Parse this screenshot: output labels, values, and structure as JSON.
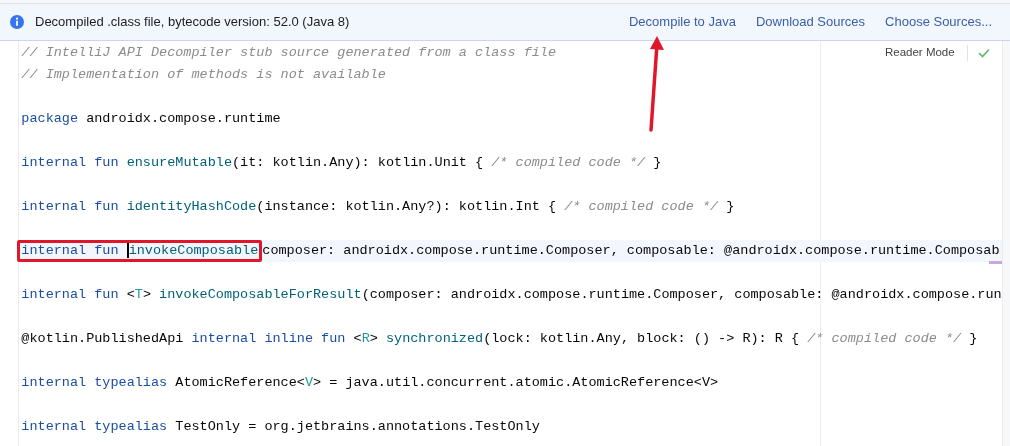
{
  "banner": {
    "message": "Decompiled .class file, bytecode version: 52.0 (Java 8)",
    "actions": [
      "Decompile to Java",
      "Download Sources",
      "Choose Sources..."
    ]
  },
  "editor": {
    "reader_mode": "Reader Mode",
    "lines": [
      {
        "kind": "code",
        "current": false,
        "tokens": [
          {
            "kind": "comment",
            "text": "// IntelliJ API Decompiler stub source generated from a class file"
          }
        ]
      },
      {
        "kind": "code",
        "current": false,
        "tokens": [
          {
            "kind": "comment",
            "text": "// Implementation of methods is not available"
          }
        ]
      },
      {
        "kind": "blank"
      },
      {
        "kind": "code",
        "current": false,
        "tokens": [
          {
            "kind": "keyword",
            "text": "package "
          },
          {
            "kind": "plain",
            "text": "androidx.compose.runtime"
          }
        ]
      },
      {
        "kind": "blank"
      },
      {
        "kind": "code",
        "current": false,
        "tokens": [
          {
            "kind": "keyword",
            "text": "internal fun "
          },
          {
            "kind": "function",
            "text": "ensureMutable"
          },
          {
            "kind": "plain",
            "text": "(it: kotlin.Any): kotlin.Unit { "
          },
          {
            "kind": "comment",
            "text": "/* compiled code */"
          },
          {
            "kind": "plain",
            "text": " }"
          }
        ]
      },
      {
        "kind": "blank"
      },
      {
        "kind": "code",
        "current": false,
        "tokens": [
          {
            "kind": "keyword",
            "text": "internal fun "
          },
          {
            "kind": "function",
            "text": "identityHashCode"
          },
          {
            "kind": "plain",
            "text": "(instance: kotlin.Any?): kotlin.Int { "
          },
          {
            "kind": "comment",
            "text": "/* compiled code */"
          },
          {
            "kind": "plain",
            "text": " }"
          }
        ]
      },
      {
        "kind": "blank"
      },
      {
        "kind": "code",
        "current": true,
        "tokens": [
          {
            "kind": "keyword",
            "text": "internal fun ",
            "boxed": true,
            "caret": false
          },
          {
            "kind": "function",
            "text": "invokeComposable",
            "boxed": true,
            "caret": true
          },
          {
            "kind": "plain",
            "text": "composer: androidx.compose.runtime.Composer, composable: @androidx.compose.runtime.Composab",
            "boxed": false,
            "caret": false
          }
        ]
      },
      {
        "kind": "blank"
      },
      {
        "kind": "code",
        "current": false,
        "tokens": [
          {
            "kind": "keyword",
            "text": "internal fun "
          },
          {
            "kind": "plain",
            "text": "<"
          },
          {
            "kind": "type_param",
            "text": "T"
          },
          {
            "kind": "plain",
            "text": "> "
          },
          {
            "kind": "function",
            "text": "invokeComposableForResult"
          },
          {
            "kind": "plain",
            "text": "(composer: androidx.compose.runtime.Composer, composable: @androidx.compose.run"
          }
        ]
      },
      {
        "kind": "blank"
      },
      {
        "kind": "code",
        "current": false,
        "tokens": [
          {
            "kind": "plain",
            "text": "@kotlin.PublishedApi "
          },
          {
            "kind": "keyword",
            "text": "internal inline fun "
          },
          {
            "kind": "plain",
            "text": "<"
          },
          {
            "kind": "type_param",
            "text": "R"
          },
          {
            "kind": "plain",
            "text": "> "
          },
          {
            "kind": "function",
            "text": "synchronized"
          },
          {
            "kind": "plain",
            "text": "(lock: kotlin.Any, block: () -> R): R { "
          },
          {
            "kind": "comment",
            "text": "/* compiled code */"
          },
          {
            "kind": "plain",
            "text": " }"
          }
        ]
      },
      {
        "kind": "blank"
      },
      {
        "kind": "code",
        "current": false,
        "tokens": [
          {
            "kind": "keyword",
            "text": "internal typealias "
          },
          {
            "kind": "plain",
            "text": "AtomicReference<"
          },
          {
            "kind": "type_param",
            "text": "V"
          },
          {
            "kind": "plain",
            "text": "> = java.util.concurrent.atomic.AtomicReference<V>"
          }
        ]
      },
      {
        "kind": "blank"
      },
      {
        "kind": "code",
        "current": false,
        "tokens": [
          {
            "kind": "keyword",
            "text": "internal typealias "
          },
          {
            "kind": "plain",
            "text": "TestOnly = org.jetbrains.annotations.TestOnly"
          }
        ]
      }
    ]
  }
}
